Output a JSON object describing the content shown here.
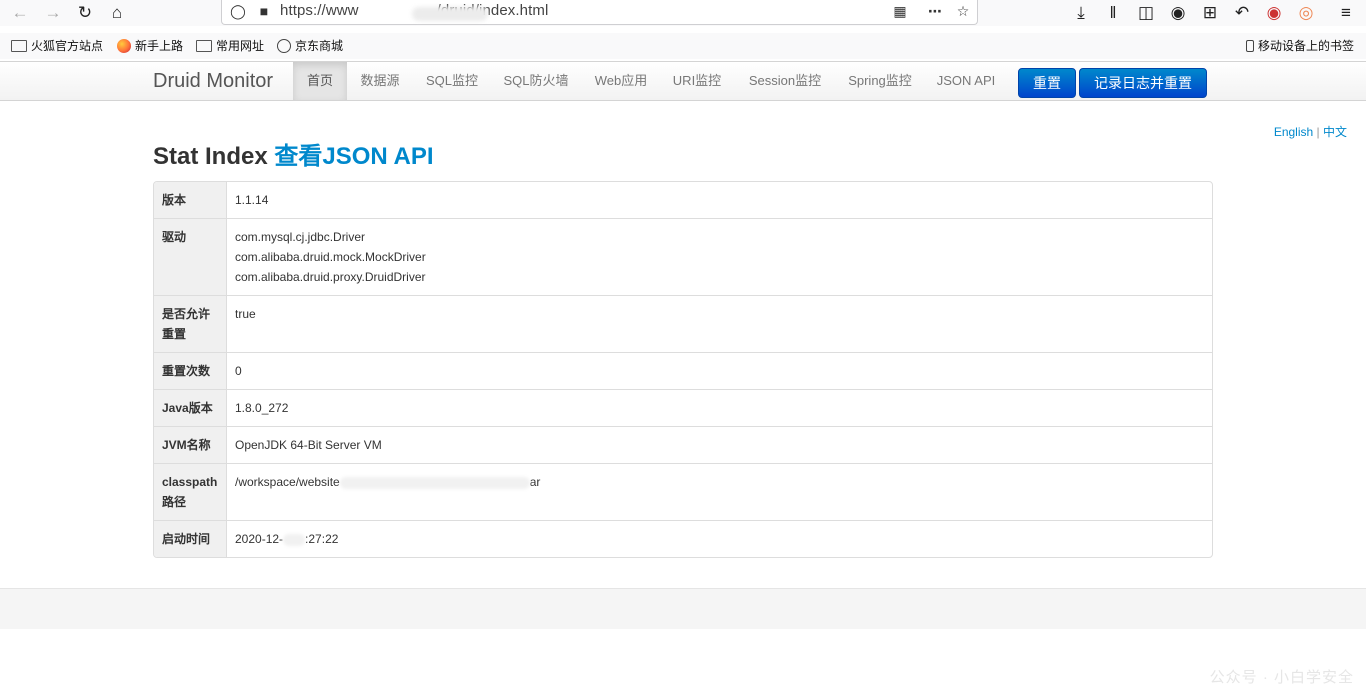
{
  "browser": {
    "url_prefix": "https://www",
    "url_suffix": "/druid/index.html"
  },
  "bookmarks": [
    {
      "label": "火狐官方站点",
      "icon": "folder-icon"
    },
    {
      "label": "新手上路",
      "icon": "firefox-icon"
    },
    {
      "label": "常用网址",
      "icon": "folder-icon"
    },
    {
      "label": "京东商城",
      "icon": "globe-icon"
    }
  ],
  "mobile_bookmarks": "移动设备上的书签",
  "navbar": {
    "brand": "Druid Monitor",
    "items": [
      "首页",
      "数据源",
      "SQL监控",
      "SQL防火墙",
      "Web应用",
      "URI监控",
      "Session监控",
      "Spring监控",
      "JSON API"
    ],
    "reset_button": "重置",
    "log_reset_button": "记录日志并重置"
  },
  "lang": {
    "english": "English",
    "separator": "|",
    "chinese": "中文"
  },
  "title": {
    "text": "Stat Index",
    "link": "查看JSON API"
  },
  "stats": {
    "version_label": "版本",
    "version": "1.1.14",
    "driver_label": "驱动",
    "drivers": [
      "com.mysql.cj.jdbc.Driver",
      "com.alibaba.druid.mock.MockDriver",
      "com.alibaba.druid.proxy.DruidDriver"
    ],
    "reset_enable_label_1": "是否允许",
    "reset_enable_label_2": "重置",
    "reset_enable": "true",
    "reset_count_label": "重置次数",
    "reset_count": "0",
    "java_version_label": "Java版本",
    "java_version": "1.8.0_272",
    "jvm_name_label": "JVM名称",
    "jvm_name": "OpenJDK 64-Bit Server VM",
    "classpath_label_1": "classpath",
    "classpath_label_2": "路径",
    "classpath_prefix": "/workspace/website",
    "classpath_suffix": "ar",
    "start_time_label": "启动时间",
    "start_time_prefix": "2020-12-",
    "start_time_suffix": ":27:22"
  },
  "watermark": "公众号 · 小白学安全"
}
